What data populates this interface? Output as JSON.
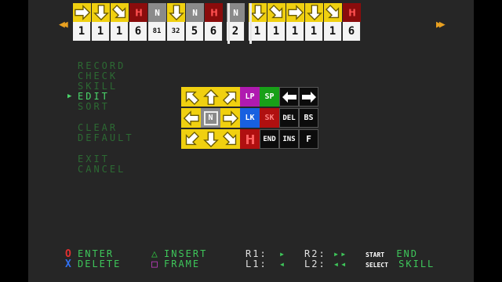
{
  "timeline": {
    "left_arrow": "◀◀",
    "right_arrow": "▶▶",
    "cells": [
      {
        "kind": "arrow",
        "dir": "right",
        "count": "1"
      },
      {
        "kind": "arrow",
        "dir": "down",
        "count": "1"
      },
      {
        "kind": "arrow",
        "dir": "downright",
        "count": "1"
      },
      {
        "kind": "red",
        "count": "6"
      },
      {
        "kind": "n",
        "label": "N",
        "count": "81"
      },
      {
        "kind": "arrow",
        "dir": "down",
        "count": "32"
      },
      {
        "kind": "n",
        "label": "N",
        "count": "5"
      },
      {
        "kind": "red",
        "count": "6"
      },
      {
        "kind": "n",
        "label": "N",
        "count": "2"
      },
      {
        "kind": "arrow",
        "dir": "down",
        "count": "1"
      },
      {
        "kind": "arrow",
        "dir": "downright",
        "count": "1"
      },
      {
        "kind": "arrow",
        "dir": "right",
        "count": "1"
      },
      {
        "kind": "arrow",
        "dir": "down",
        "count": "1"
      },
      {
        "kind": "arrow",
        "dir": "downright",
        "count": "1"
      },
      {
        "kind": "red",
        "count": "6"
      }
    ]
  },
  "menu": {
    "items": [
      "RECORD",
      "CHECK",
      "SKILL",
      "EDIT",
      "SORT",
      "CLEAR",
      "DEFAULT",
      "EXIT",
      "CANCEL"
    ],
    "selected": "EDIT",
    "cursor": "▶"
  },
  "palette": {
    "n_label": "N",
    "lp": "LP",
    "sp": "SP",
    "lk": "LK",
    "sk": "SK",
    "del": "DEL",
    "bs": "BS",
    "end": "END",
    "ins": "INS",
    "f": "F"
  },
  "legend": {
    "circle_sym": "O",
    "enter": "ENTER",
    "cross_sym": "X",
    "delete": "DELETE",
    "triangle_sym": "△",
    "insert": "INSERT",
    "square_sym": "□",
    "frame": "FRAME",
    "r1": "R1:",
    "r1_val": "▸",
    "l1": "L1:",
    "l1_val": "◂",
    "r2": "R2:",
    "r2_val": "▸▸",
    "l2": "L2:",
    "l2_val": "◂◂",
    "start_tag": "START",
    "end": "END",
    "select_tag": "SELECT",
    "skill": "SKILL"
  },
  "colors": {
    "yellow": "#f0d010",
    "red": "#8a0c0c",
    "menu_dim": "#2c6a33",
    "menu_active": "#4ad66a",
    "legend_circle": "#e03030",
    "legend_cross": "#3070f0",
    "legend_triangle": "#30c040",
    "legend_square": "#d040d0"
  }
}
